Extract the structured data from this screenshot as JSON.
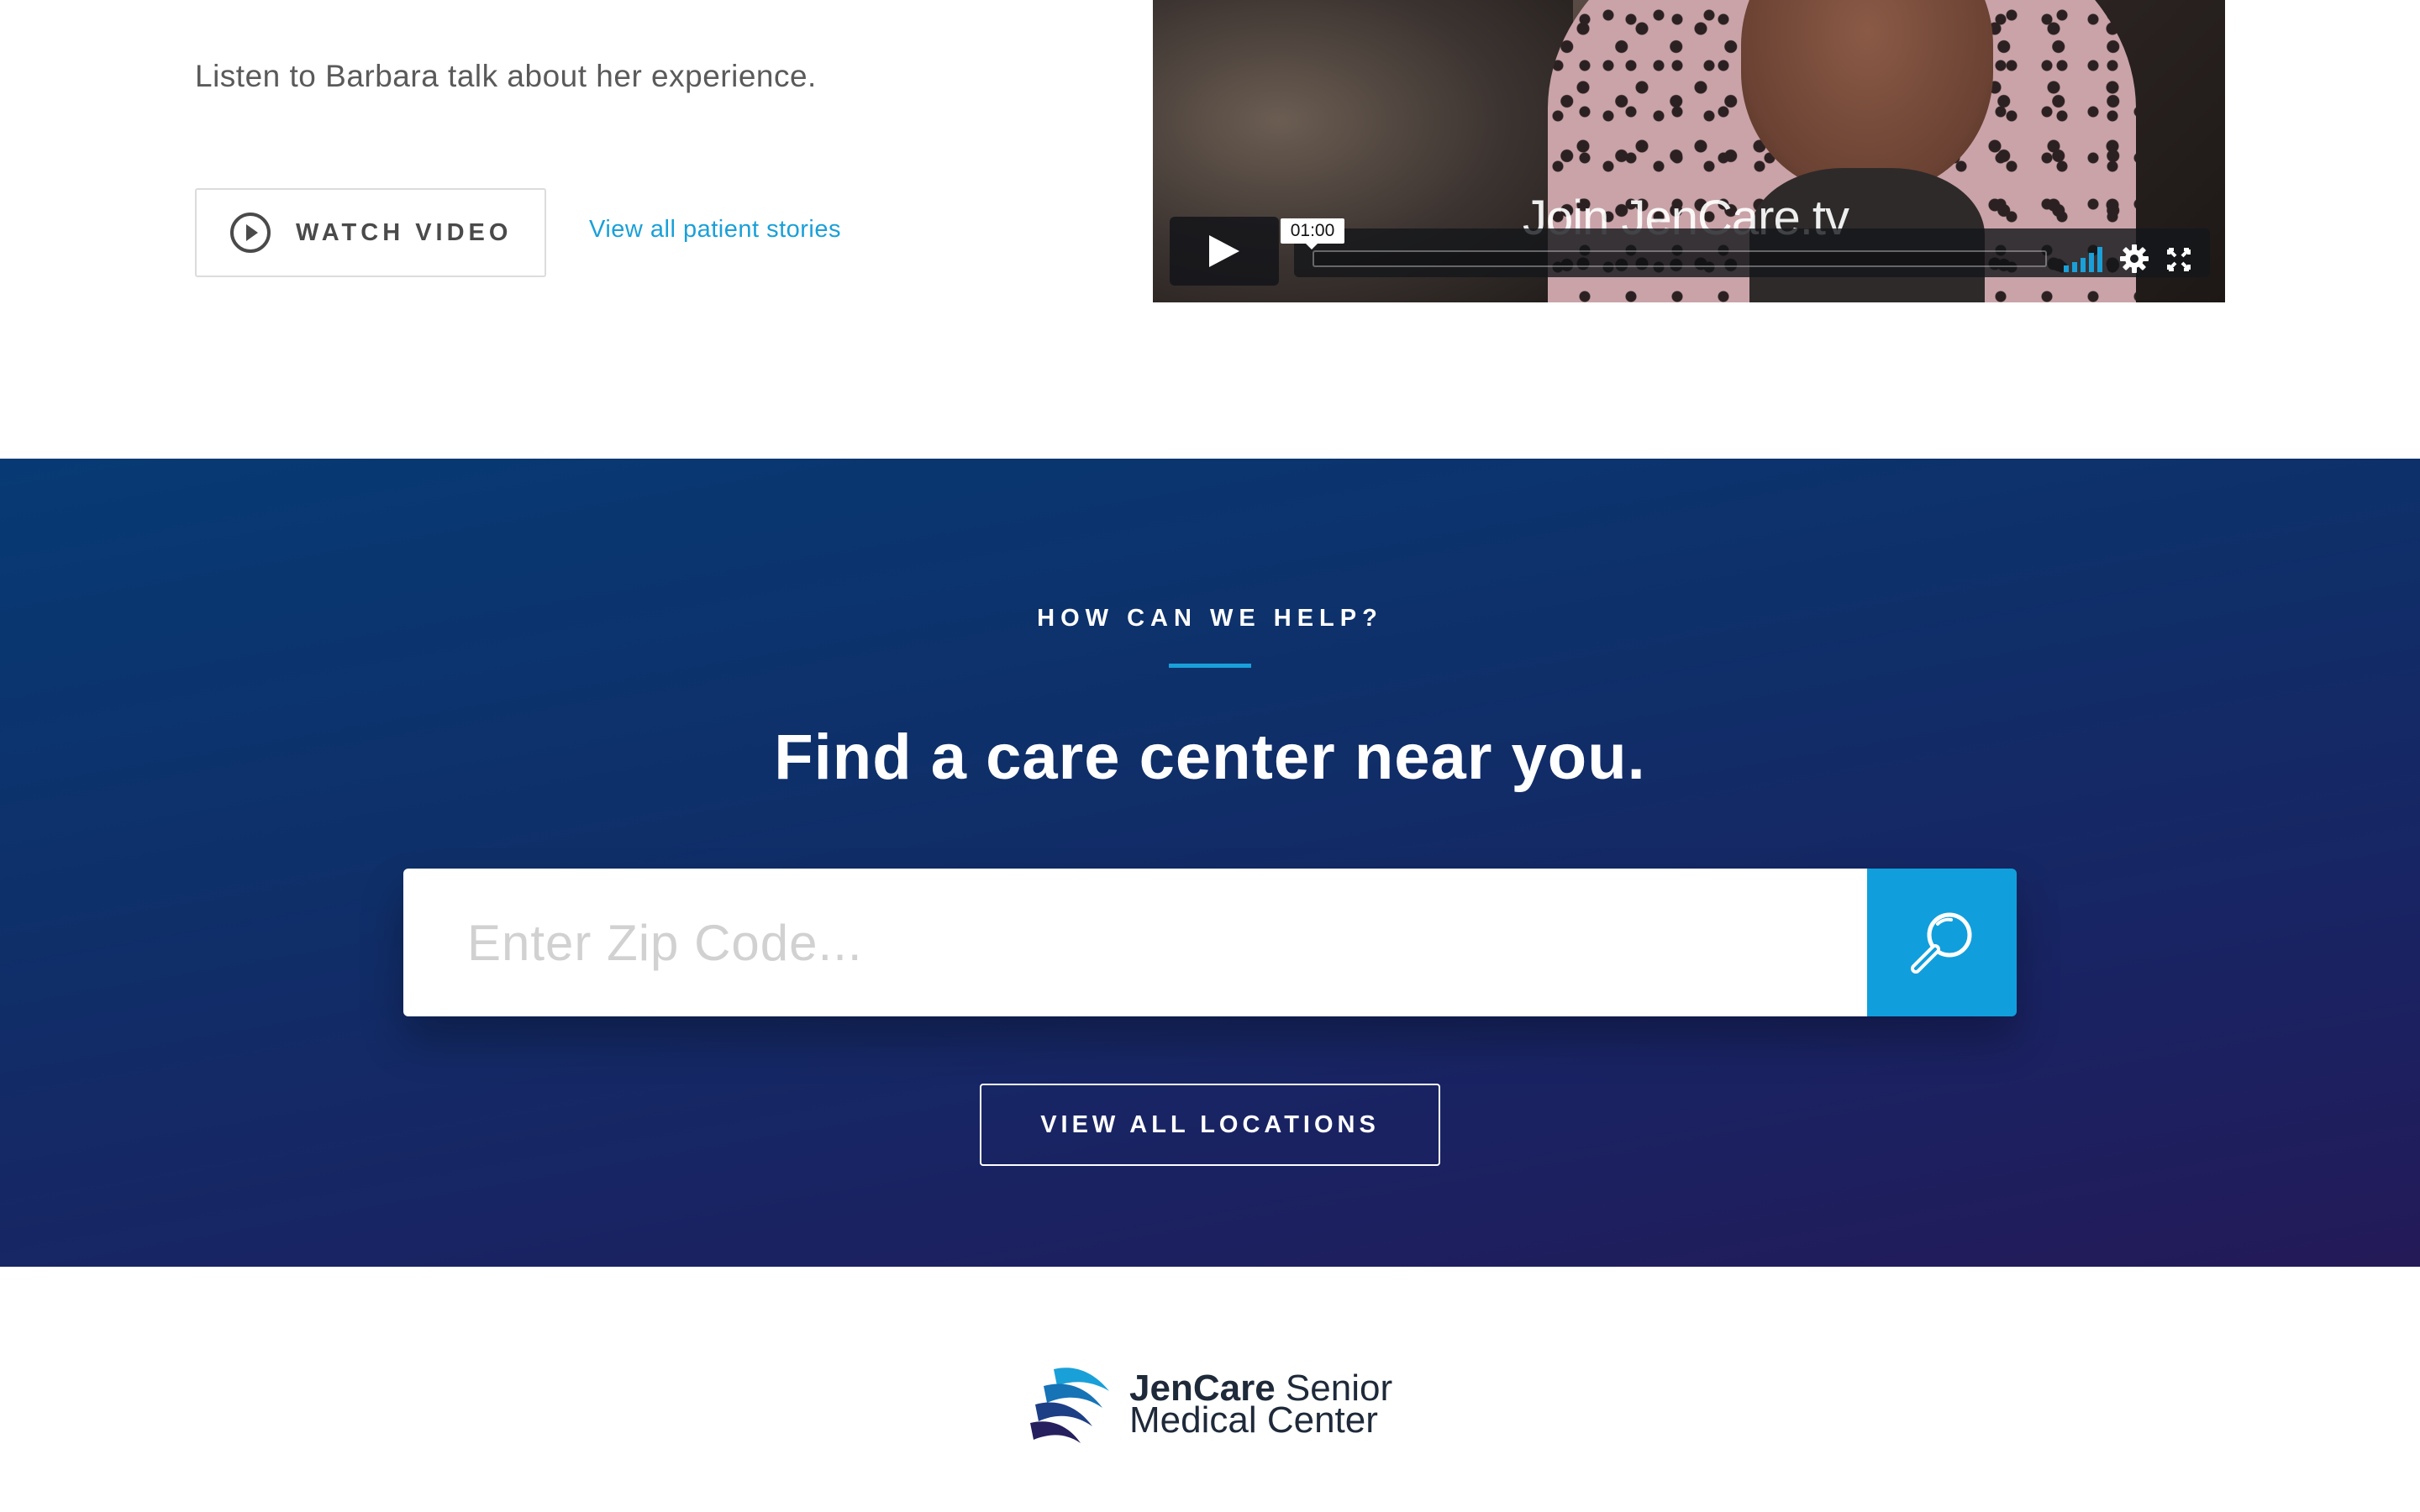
{
  "story": {
    "intro_text": "Listen to Barbara talk about her experience.",
    "watch_video_label": "WATCH VIDEO",
    "patient_stories_link": "View all patient stories"
  },
  "video": {
    "overlay_title": "Join JenCare.tv",
    "time_tooltip": "01:00",
    "accent_color": "#1aa0d8"
  },
  "help": {
    "eyebrow": "HOW CAN WE HELP?",
    "heading": "Find a care center near you.",
    "zip_placeholder": "Enter Zip Code...",
    "zip_value": "",
    "view_locations_label": "VIEW ALL LOCATIONS",
    "search_button_color": "#109fdc"
  },
  "footer": {
    "logo_brand": "JenCare",
    "logo_suffix": "Senior",
    "logo_line2": "Medical Center"
  },
  "icons": {
    "watch_video": "play-circle-icon",
    "video_play": "play-icon",
    "volume": "volume-bars-icon",
    "settings": "gear-icon",
    "fullscreen": "fullscreen-icon",
    "search": "search-icon"
  }
}
